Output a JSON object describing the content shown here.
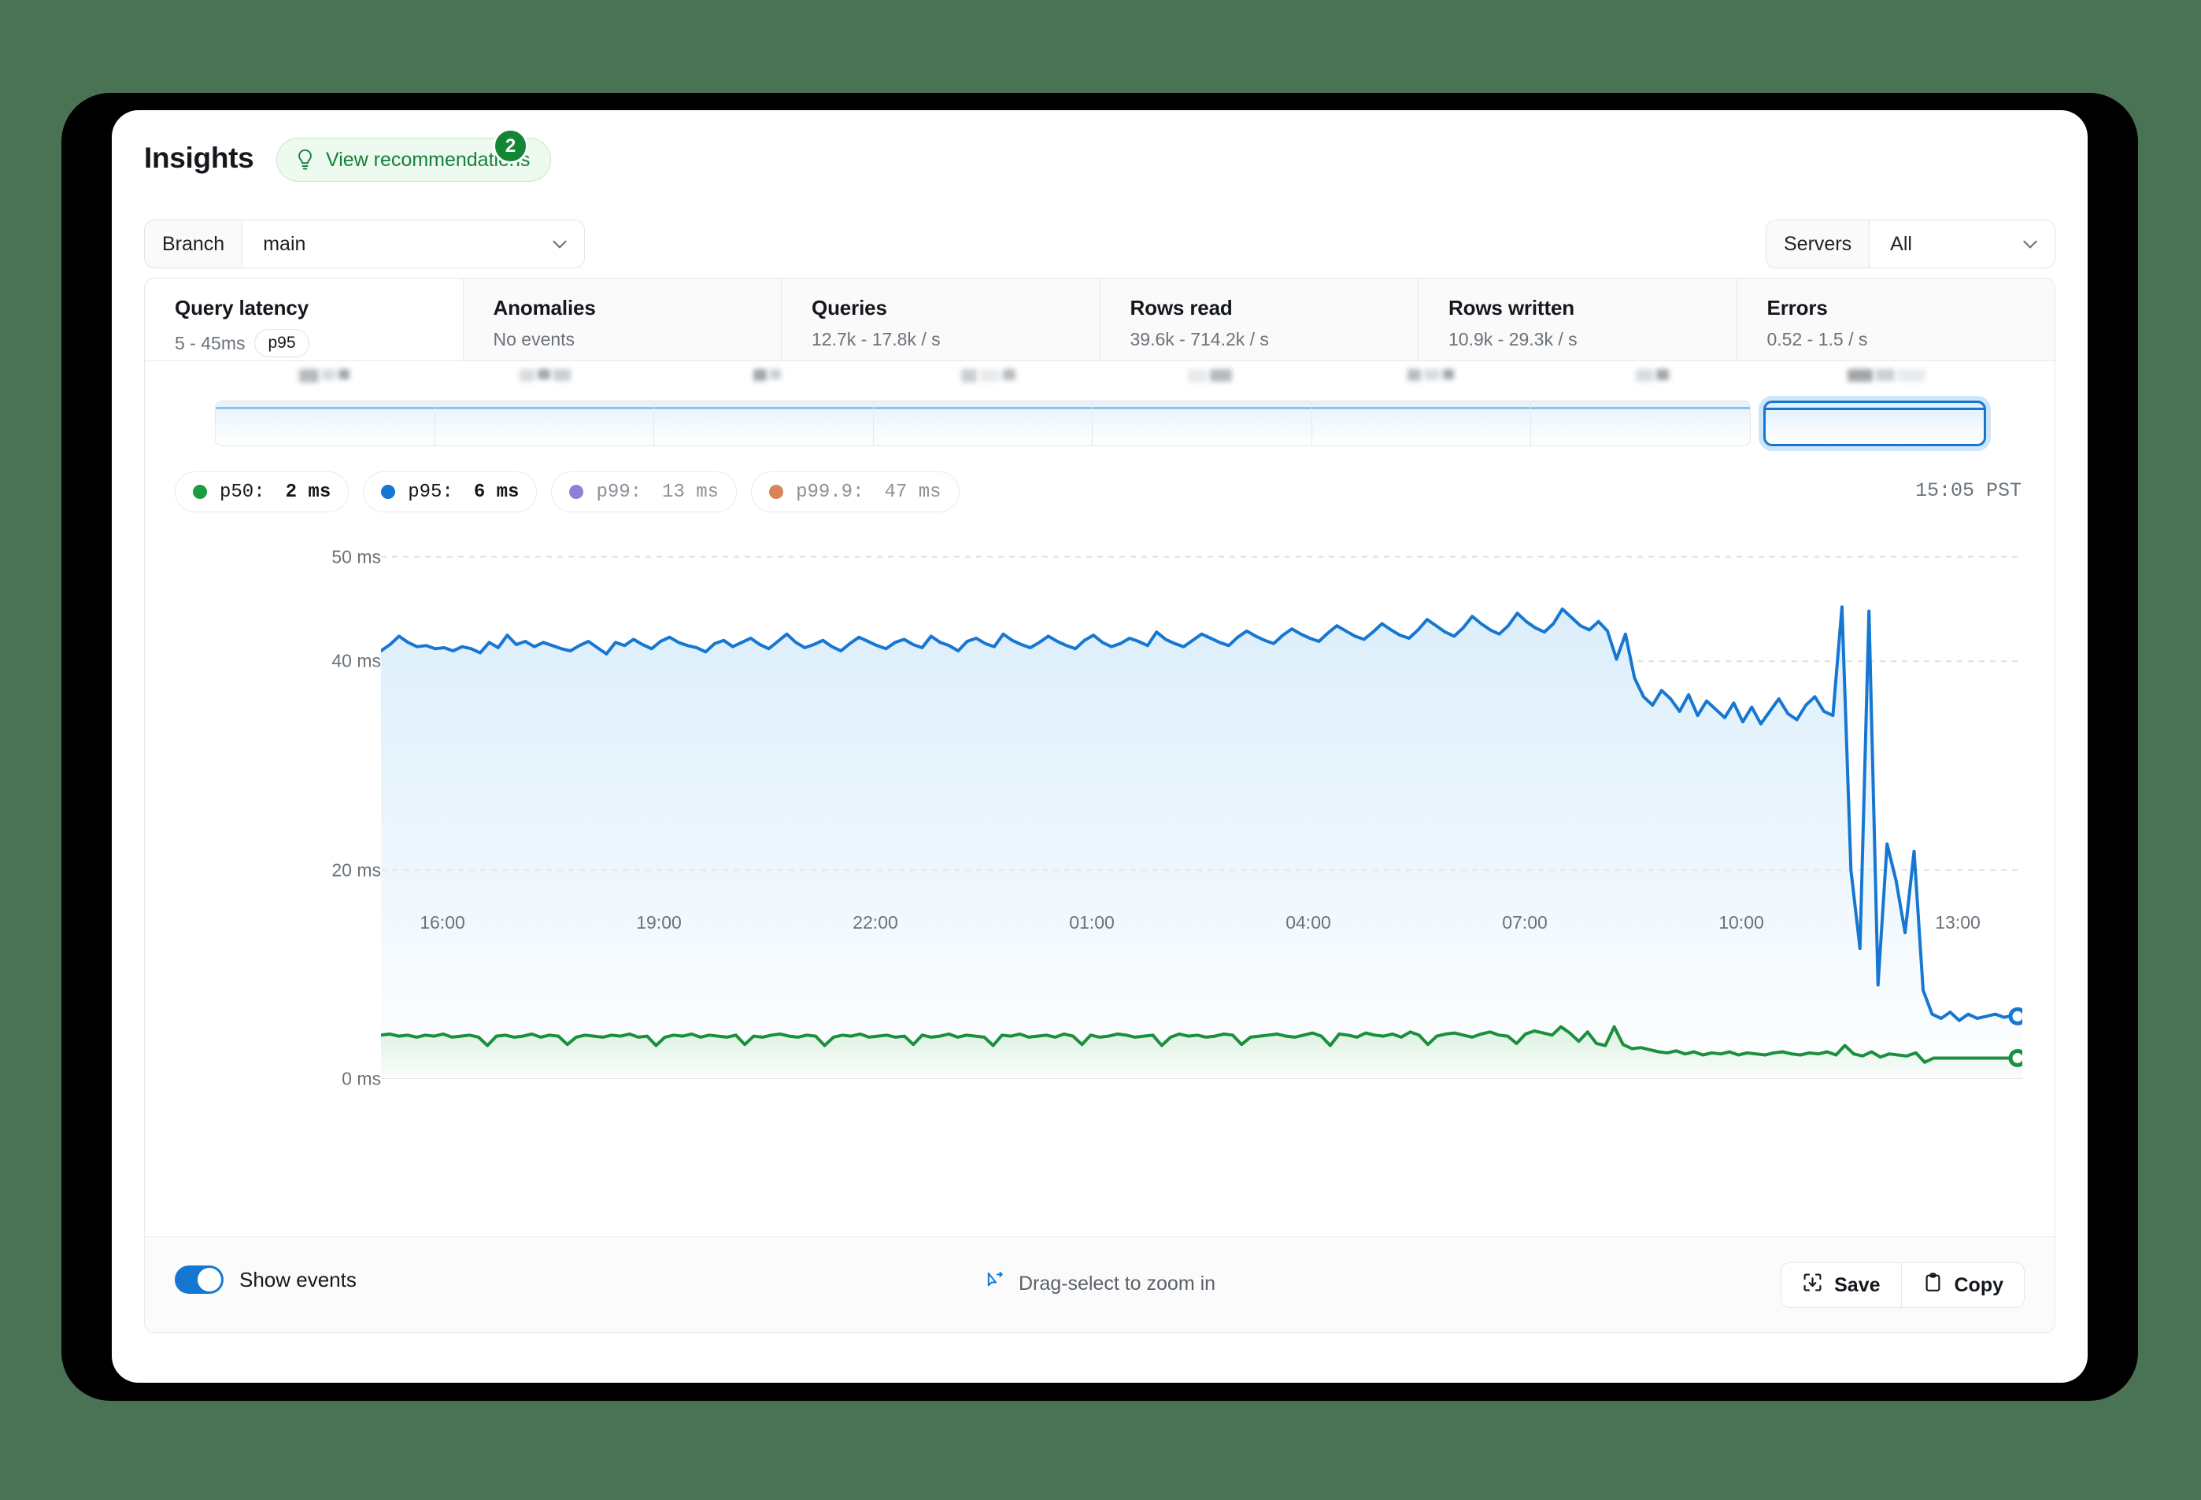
{
  "header": {
    "title": "Insights",
    "recommendations_label": "View recommendations",
    "recommendations_count": "2",
    "bulb_icon": "lightbulb-icon"
  },
  "filters": {
    "branch": {
      "label": "Branch",
      "value": "main",
      "chevron_icon": "chevron-down-icon"
    },
    "servers": {
      "label": "Servers",
      "value": "All",
      "chevron_icon": "chevron-down-icon"
    }
  },
  "metric_tabs": [
    {
      "title": "Query latency",
      "sub": "5 - 45ms",
      "badge": "p95",
      "active": true
    },
    {
      "title": "Anomalies",
      "sub": "No events",
      "badge": "",
      "active": false
    },
    {
      "title": "Queries",
      "sub": "12.7k - 17.8k / s",
      "badge": "",
      "active": false
    },
    {
      "title": "Rows read",
      "sub": "39.6k - 714.2k / s",
      "badge": "",
      "active": false
    },
    {
      "title": "Rows written",
      "sub": "10.9k - 29.3k / s",
      "badge": "",
      "active": false
    },
    {
      "title": "Errors",
      "sub": "0.52 - 1.5 / s",
      "badge": "",
      "active": false
    }
  ],
  "timeline": {
    "segments": 8,
    "selected_index": 7,
    "labels_redacted": true
  },
  "legend": [
    {
      "name": "p50:",
      "value": "2 ms",
      "color": "#1a9e3f",
      "active": true
    },
    {
      "name": "p95:",
      "value": "6 ms",
      "color": "#1677d2",
      "active": true
    },
    {
      "name": "p99:",
      "value": "13 ms",
      "color": "#8b82d6",
      "active": false
    },
    {
      "name": "p99.9:",
      "value": "47 ms",
      "color": "#d98459",
      "active": false
    }
  ],
  "timestamp": "15:05 PST",
  "footer": {
    "show_events_label": "Show events",
    "show_events_on": true,
    "drag_hint": "Drag-select to zoom in",
    "cursor_icon": "drag-select-cursor-icon",
    "save_label": "Save",
    "save_icon": "download-icon",
    "copy_label": "Copy",
    "copy_icon": "clipboard-icon"
  },
  "chart_data": {
    "type": "area",
    "title": "Query latency",
    "xlabel": "",
    "ylabel": "ms",
    "ylim": [
      0,
      52
    ],
    "yticks": [
      0,
      20,
      40,
      50
    ],
    "ytick_labels": [
      "0 ms",
      "20 ms",
      "40 ms",
      "50 ms"
    ],
    "grid": true,
    "grid_axis": "y",
    "legend_position": "top-left",
    "xticks": [
      "16:00",
      "19:00",
      "22:00",
      "01:00",
      "04:00",
      "07:00",
      "10:00",
      "13:00"
    ],
    "xlim_hours": [
      15.2,
      15.1
    ],
    "series": [
      {
        "name": "p95",
        "color": "#1677d2",
        "fill": "#dceefb",
        "end_marker": true,
        "end_value": 6,
        "values": [
          41.0,
          41.6,
          42.4,
          41.8,
          41.4,
          41.5,
          41.2,
          41.3,
          41.0,
          41.4,
          41.2,
          40.8,
          41.8,
          41.3,
          42.5,
          41.6,
          41.9,
          41.4,
          41.8,
          41.5,
          41.2,
          41.0,
          41.5,
          41.9,
          41.3,
          40.7,
          41.8,
          41.5,
          42.1,
          41.6,
          41.2,
          41.9,
          42.3,
          41.8,
          41.5,
          41.3,
          40.9,
          41.7,
          42.0,
          41.4,
          41.8,
          42.2,
          41.6,
          41.2,
          41.9,
          42.6,
          41.8,
          41.3,
          41.6,
          42.0,
          41.4,
          41.0,
          41.7,
          42.3,
          41.9,
          41.5,
          41.2,
          41.8,
          42.1,
          41.6,
          41.3,
          42.4,
          41.8,
          41.5,
          41.0,
          41.9,
          42.2,
          41.7,
          41.4,
          42.6,
          42.0,
          41.6,
          41.3,
          41.8,
          42.4,
          41.9,
          41.5,
          41.2,
          42.0,
          42.5,
          41.8,
          41.4,
          41.7,
          42.2,
          41.9,
          41.5,
          42.8,
          42.1,
          41.7,
          41.4,
          42.0,
          42.6,
          42.2,
          41.8,
          41.5,
          42.3,
          42.9,
          42.4,
          42.0,
          41.7,
          42.5,
          43.1,
          42.6,
          42.2,
          41.9,
          42.7,
          43.4,
          42.9,
          42.4,
          42.1,
          42.8,
          43.6,
          43.0,
          42.5,
          42.2,
          43.0,
          44.0,
          43.4,
          42.8,
          42.4,
          43.2,
          44.3,
          43.6,
          43.0,
          42.6,
          43.4,
          44.6,
          43.8,
          43.2,
          42.8,
          43.6,
          45.0,
          44.2,
          43.4,
          43.0,
          43.8,
          42.9,
          40.2,
          42.6,
          38.4,
          36.6,
          35.8,
          37.2,
          36.4,
          35.2,
          36.8,
          34.8,
          36.2,
          35.4,
          34.6,
          36.0,
          34.2,
          35.6,
          34.0,
          35.2,
          36.4,
          35.0,
          34.4,
          35.8,
          36.6,
          35.2,
          34.8,
          45.2,
          20.0,
          12.5,
          44.8,
          9.0,
          22.5,
          19.0,
          14.0,
          21.8,
          8.5,
          6.2,
          5.8,
          6.4,
          5.6,
          6.2,
          5.8,
          6.0,
          6.2,
          5.9,
          6.1,
          6.0
        ]
      },
      {
        "name": "p50",
        "color": "#1a8f3c",
        "fill": "#dcf2e0",
        "end_marker": true,
        "end_value": 2,
        "values": [
          4.2,
          4.3,
          4.1,
          4.2,
          4.0,
          4.2,
          4.1,
          4.3,
          4.0,
          4.1,
          4.2,
          4.0,
          3.2,
          4.1,
          4.2,
          4.0,
          4.1,
          4.3,
          4.0,
          4.2,
          4.1,
          3.3,
          4.0,
          4.2,
          4.1,
          4.0,
          4.2,
          4.1,
          4.3,
          4.0,
          4.1,
          3.2,
          4.0,
          4.2,
          4.1,
          4.3,
          4.0,
          4.2,
          4.1,
          4.0,
          4.2,
          3.3,
          4.1,
          4.0,
          4.2,
          4.3,
          4.1,
          4.0,
          4.2,
          4.1,
          3.2,
          4.0,
          4.2,
          4.1,
          4.3,
          4.0,
          4.1,
          4.2,
          4.0,
          4.1,
          3.3,
          4.2,
          4.0,
          4.1,
          4.3,
          4.0,
          4.2,
          4.1,
          4.0,
          3.2,
          4.2,
          4.1,
          4.3,
          4.0,
          4.1,
          4.2,
          4.0,
          4.3,
          4.1,
          3.3,
          4.2,
          4.0,
          4.1,
          4.3,
          4.2,
          4.0,
          4.1,
          4.2,
          3.2,
          4.0,
          4.3,
          4.1,
          4.2,
          4.0,
          4.1,
          4.3,
          4.2,
          3.3,
          4.0,
          4.1,
          4.2,
          4.3,
          4.1,
          4.0,
          4.2,
          4.4,
          4.1,
          3.2,
          4.3,
          4.2,
          4.0,
          4.4,
          4.2,
          4.1,
          4.3,
          4.0,
          4.5,
          4.2,
          3.3,
          4.1,
          4.3,
          4.4,
          4.2,
          4.0,
          4.3,
          4.5,
          4.2,
          4.1,
          3.4,
          4.3,
          4.6,
          4.4,
          4.2,
          5.0,
          4.4,
          3.6,
          4.5,
          3.4,
          3.2,
          5.0,
          3.3,
          2.9,
          3.0,
          2.8,
          2.6,
          2.5,
          2.7,
          2.4,
          2.6,
          2.3,
          2.5,
          2.4,
          2.6,
          2.3,
          2.5,
          2.4,
          2.3,
          2.5,
          2.6,
          2.4,
          2.3,
          2.5,
          2.4,
          2.6,
          2.3,
          3.2,
          2.4,
          2.2,
          2.6,
          2.1,
          2.4,
          2.3,
          2.2,
          2.5,
          1.6,
          2.0,
          2.0,
          2.0,
          2.0,
          2.0,
          2.0,
          2.0,
          2.0,
          2.0,
          2.0,
          2.0
        ]
      }
    ]
  }
}
